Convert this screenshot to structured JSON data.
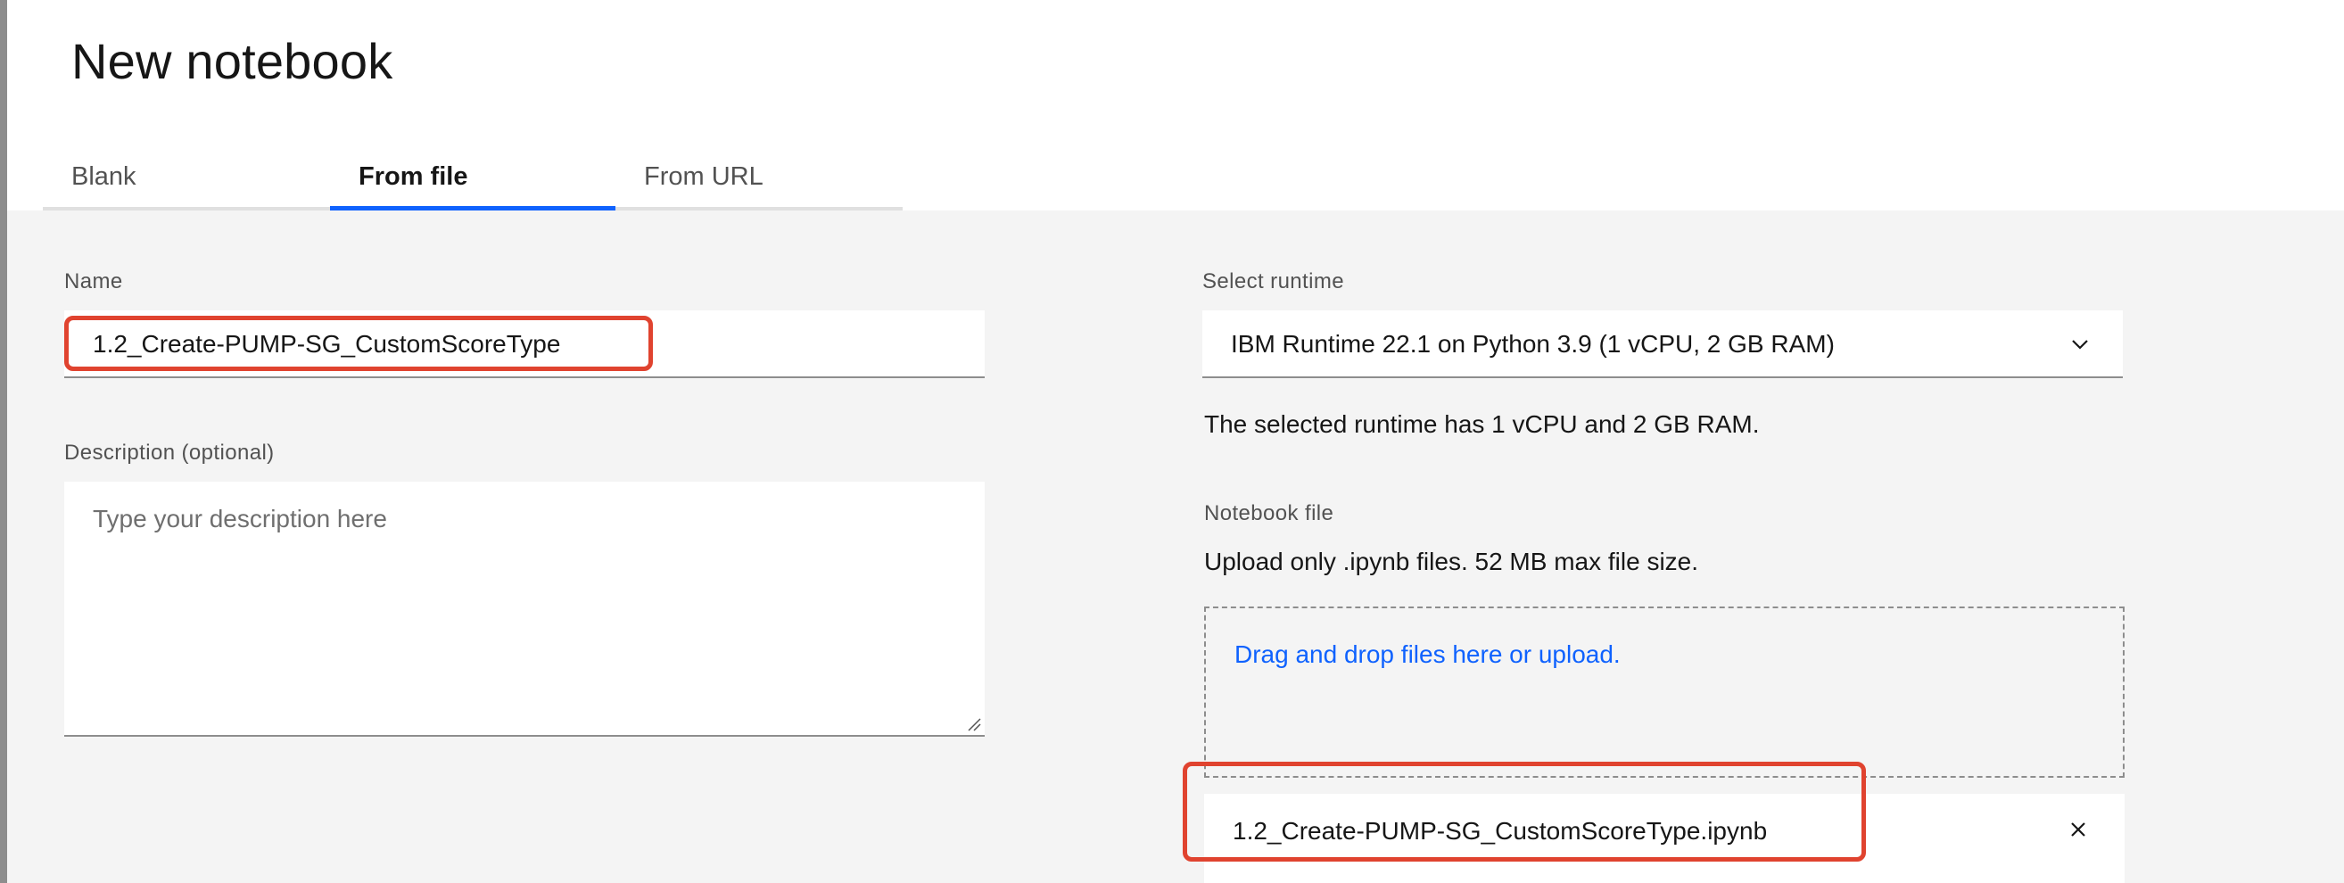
{
  "title": "New notebook",
  "tabs": [
    {
      "label": "Blank",
      "active": false
    },
    {
      "label": "From file",
      "active": true
    },
    {
      "label": "From URL",
      "active": false
    }
  ],
  "form": {
    "name_label": "Name",
    "name_value": "1.2_Create-PUMP-SG_CustomScoreType",
    "description_label": "Description (optional)",
    "description_placeholder": "Type your description here",
    "runtime_label": "Select runtime",
    "runtime_value": "IBM Runtime 22.1 on Python 3.9 (1 vCPU, 2 GB RAM)",
    "runtime_helper": "The selected runtime has 1 vCPU and 2 GB RAM.",
    "notebook_file_label": "Notebook file",
    "notebook_file_helper": "Upload only .ipynb files. 52 MB max file size.",
    "dropzone_text": "Drag and drop files here or upload.",
    "uploaded_file": "1.2_Create-PUMP-SG_CustomScoreType.ipynb"
  },
  "colors": {
    "accent": "#0f62fe",
    "highlight": "#e0432f",
    "background": "#f4f4f4"
  },
  "icons": {
    "select_chevron": "chevron-down-icon",
    "remove_file": "close-icon"
  }
}
